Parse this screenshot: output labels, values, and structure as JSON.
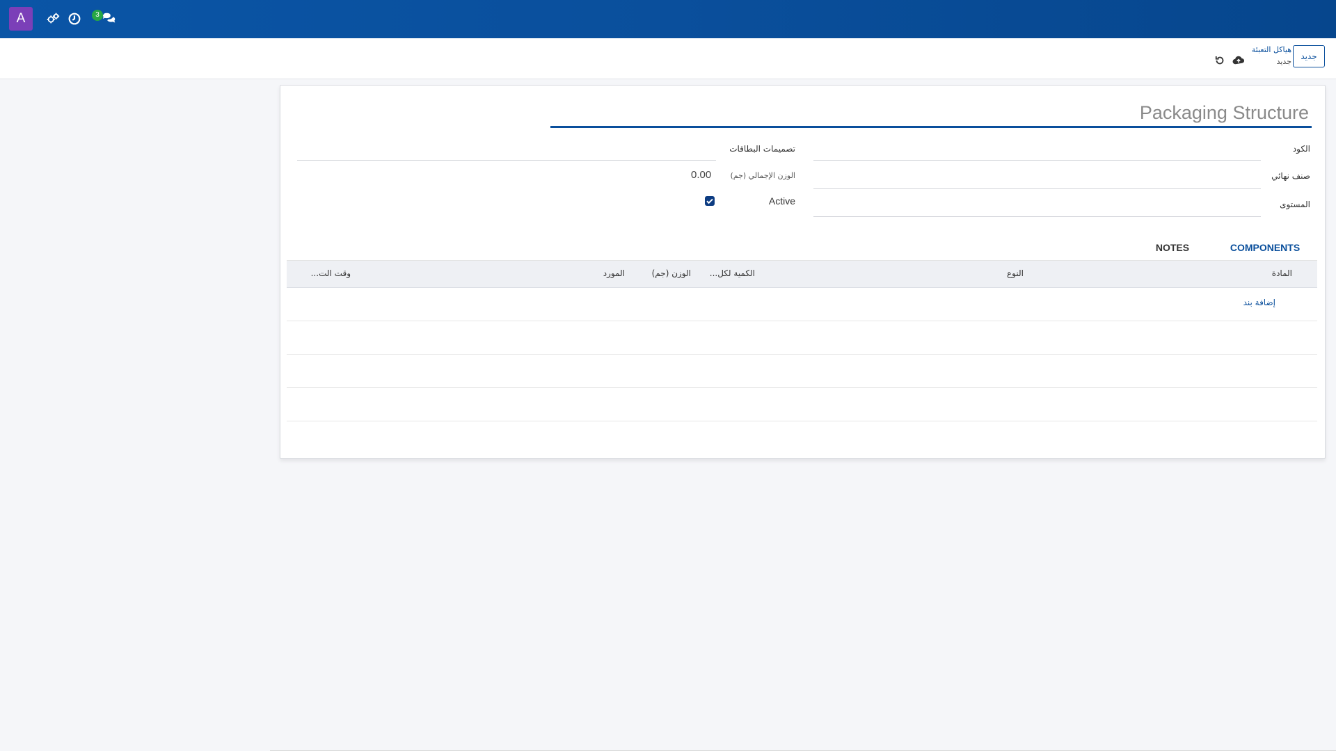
{
  "navbar": {
    "avatar_letter": "A",
    "icons": [
      "settings-gears-icon",
      "clock-icon",
      "chat-icon"
    ],
    "message_count": "3",
    "color": "#0a4f9c"
  },
  "control_panel": {
    "new_label": "جديد",
    "breadcrumb_parent": "هياكل التعبئة",
    "breadcrumb_current": "جديد"
  },
  "form": {
    "title_placeholder": "Packaging Structure",
    "left_fields": {
      "code_label": "الكود",
      "final_category_label": "صنف نهائي",
      "level_label": "المستوى"
    },
    "right_fields": {
      "label_designs_label": "تصميمات البطاقات",
      "total_weight_label": "الوزن الإجمالي (جم)",
      "total_weight_value": "0.00",
      "active_label": "Active",
      "active_checked": true
    },
    "tabs": [
      {
        "label": "COMPONENTS",
        "active": true
      },
      {
        "label": "NOTES",
        "active": false
      }
    ]
  },
  "components_table": {
    "columns": [
      "المادة",
      "النوع",
      "الكمية لكل...",
      "الوزن (جم)",
      "المورد",
      "وقت الت..."
    ],
    "add_line_label": "إضافة بند"
  }
}
